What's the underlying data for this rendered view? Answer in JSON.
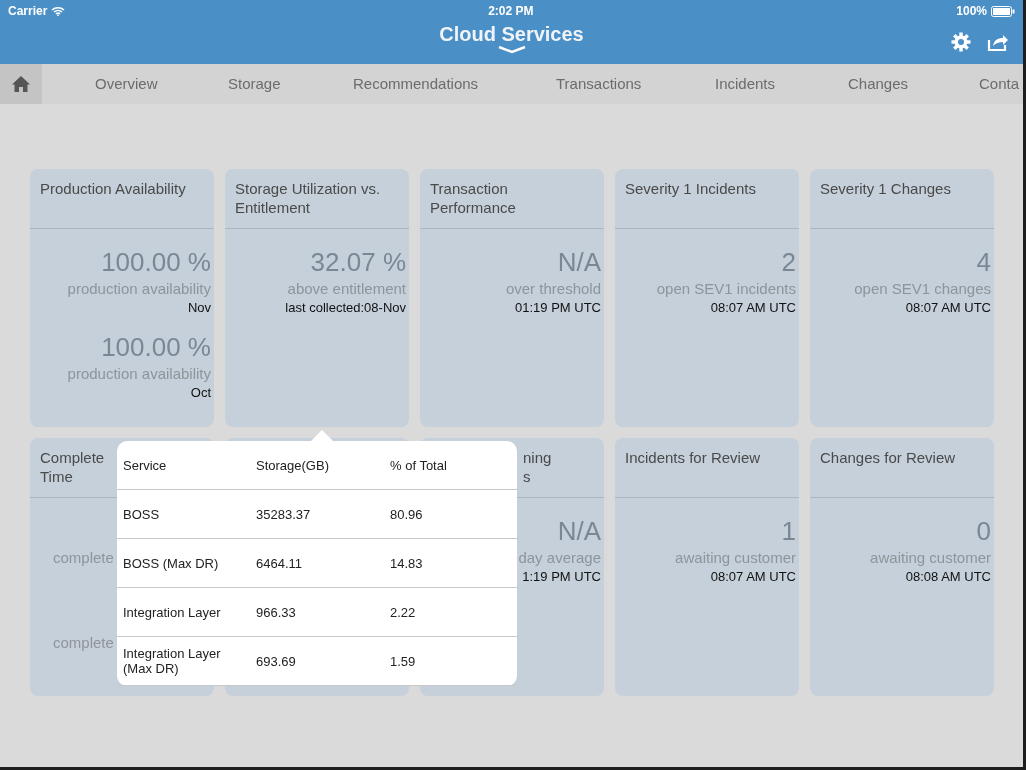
{
  "status_bar": {
    "carrier": "Carrier",
    "time": "2:02 PM",
    "battery": "100%"
  },
  "header": {
    "title": "Cloud Services"
  },
  "nav": [
    {
      "kind": "home",
      "selected": true
    },
    {
      "label": "Overview",
      "kind": "text",
      "selected": false
    },
    {
      "label": "Storage",
      "kind": "text",
      "selected": false
    },
    {
      "label": "Recommendations",
      "kind": "text",
      "selected": false
    },
    {
      "label": "Transactions",
      "kind": "text",
      "selected": false
    },
    {
      "label": "Incidents",
      "kind": "text",
      "selected": false
    },
    {
      "label": "Changes",
      "kind": "text",
      "selected": false
    },
    {
      "label": "Conta",
      "kind": "text",
      "selected": false
    }
  ],
  "cards": [
    {
      "kind": "full",
      "title_lines": [
        "Production Availability"
      ],
      "metrics": [
        {
          "value": "100.00 %",
          "label": "production availability",
          "date": "Nov"
        },
        {
          "value": "100.00 %",
          "label": "production availability",
          "date": "Oct"
        }
      ]
    },
    {
      "kind": "full",
      "title_lines": [
        "Storage Utilization vs.",
        "Entitlement"
      ],
      "metrics": [
        {
          "value": "32.07 %",
          "label": "above entitlement",
          "date": "last collected:08-Nov"
        }
      ]
    },
    {
      "kind": "full",
      "title_lines": [
        "Transaction",
        "Performance"
      ],
      "metrics": [
        {
          "value": "N/A",
          "label": "over threshold",
          "date": "01:19 PM UTC"
        }
      ]
    },
    {
      "kind": "full",
      "title_lines": [
        "Severity 1 Incidents"
      ],
      "metrics": [
        {
          "value": "2",
          "label": "open SEV1 incidents",
          "date": "08:07 AM UTC"
        }
      ]
    },
    {
      "kind": "full",
      "title_lines": [
        "Severity 1 Changes"
      ],
      "metrics": [
        {
          "value": "4",
          "label": "open SEV1 changes",
          "date": "08:07 AM UTC"
        }
      ]
    },
    {
      "kind": "left-part",
      "title_lines": [
        "Complete",
        "Time"
      ],
      "metrics": [
        {
          "label": "complete"
        },
        {
          "label": "complete"
        }
      ]
    },
    {
      "kind": "hidden"
    },
    {
      "kind": "right-part",
      "title_lines": [
        "ning",
        "s"
      ],
      "metrics": [
        {
          "value": "N/A",
          "label": "day average",
          "date": "1:19 PM UTC"
        }
      ]
    },
    {
      "kind": "full",
      "title_lines": [
        "Incidents for Review"
      ],
      "metrics": [
        {
          "value": "1",
          "label": "awaiting customer",
          "date": "08:07 AM UTC"
        }
      ]
    },
    {
      "kind": "full",
      "title_lines": [
        "Changes for Review"
      ],
      "metrics": [
        {
          "value": "0",
          "label": "awaiting customer",
          "date": "08:08 AM UTC"
        }
      ]
    }
  ],
  "popover": {
    "columns": [
      "Service",
      "Storage(GB)",
      "% of Total"
    ],
    "rows": [
      [
        "BOSS",
        "35283.37",
        "80.96"
      ],
      [
        "BOSS (Max DR)",
        "6464.11",
        "14.83"
      ],
      [
        "Integration Layer",
        "966.33",
        "2.22"
      ],
      [
        "Integration Layer (Max DR)",
        "693.69",
        "1.59"
      ]
    ]
  }
}
